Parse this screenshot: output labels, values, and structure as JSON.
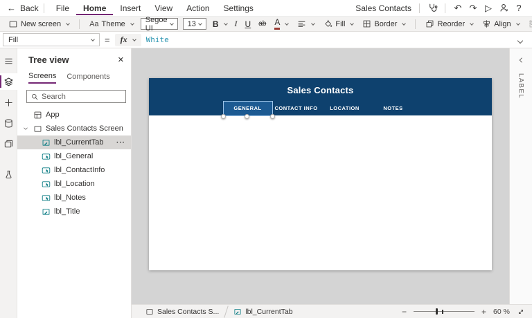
{
  "colors": {
    "accent": "#742774",
    "control_teal": "#0b7c84",
    "formula_text": "#2b95b1"
  },
  "menubar": {
    "back_label": "Back",
    "back_glyph": "←",
    "items": [
      "File",
      "Home",
      "Insert",
      "View",
      "Action",
      "Settings"
    ],
    "active_item": "Home",
    "app_title": "Sales Contacts",
    "undo_glyph": "↶",
    "redo_glyph": "↷",
    "play_glyph": "▷",
    "help_glyph": "?"
  },
  "toolbar": {
    "new_screen_label": "New screen",
    "theme_label": "Theme",
    "theme_glyph": "Aa",
    "font_name": "Segoe UI",
    "font_size": "13",
    "bold_label": "B",
    "italic_label": "I",
    "underline_label": "U",
    "strikethrough_label": "ab",
    "font_color_label": "A",
    "fill_label": "Fill",
    "border_label": "Border",
    "reorder_label": "Reorder",
    "align_label": "Align",
    "group_label": "Group"
  },
  "formula_bar": {
    "property": "Fill",
    "equals": "=",
    "fx_label": "fx",
    "formula": "White"
  },
  "left_rail": {
    "items": [
      {
        "icon": "hamburger-icon"
      },
      {
        "icon": "tree-view-icon",
        "active": true
      },
      {
        "icon": "plus-icon"
      },
      {
        "icon": "data-sources-icon"
      },
      {
        "icon": "media-icon"
      },
      {
        "icon": "advanced-tools-icon",
        "gap": true
      }
    ]
  },
  "tree_panel": {
    "title": "Tree view",
    "close_glyph": "✕",
    "tabs": [
      "Screens",
      "Components"
    ],
    "active_tab": "Screens",
    "search_placeholder": "Search",
    "more_glyph": "···",
    "items": [
      {
        "icon": "app-icon",
        "label": "App",
        "level": 0,
        "gray": true
      },
      {
        "icon": "screen-icon",
        "label": "Sales Contacts Screen",
        "level": 0,
        "gray": true,
        "expanded": true
      },
      {
        "icon": "label-icon",
        "label": "lbl_CurrentTab",
        "level": 1,
        "selected": true,
        "more": true
      },
      {
        "icon": "interactive-label-icon",
        "label": "lbl_General",
        "level": 1
      },
      {
        "icon": "interactive-label-icon",
        "label": "lbl_ContactInfo",
        "level": 1
      },
      {
        "icon": "interactive-label-icon",
        "label": "lbl_Location",
        "level": 1
      },
      {
        "icon": "interactive-label-icon",
        "label": "lbl_Notes",
        "level": 1
      },
      {
        "icon": "label-icon",
        "label": "lbl_Title",
        "level": 1
      }
    ]
  },
  "canvas": {
    "title": "Sales Contacts",
    "header_color": "#0e416e",
    "selected_tab_color": "#1c5a92",
    "tabs": [
      {
        "label": "GENERAL",
        "selected": true
      },
      {
        "label": "CONTACT INFO",
        "selected": false
      },
      {
        "label": "LOCATION",
        "selected": false
      },
      {
        "label": "NOTES",
        "selected": false
      }
    ]
  },
  "right_panel": {
    "label": "LABEL"
  },
  "statusbar": {
    "breadcrumbs": [
      {
        "icon": "screen-icon",
        "label": "Sales Contacts S..."
      },
      {
        "icon": "label-icon",
        "label": "lbl_CurrentTab"
      }
    ],
    "zoom_minus": "−",
    "zoom_plus": "+",
    "zoom_value": "60",
    "zoom_unit": "%"
  }
}
